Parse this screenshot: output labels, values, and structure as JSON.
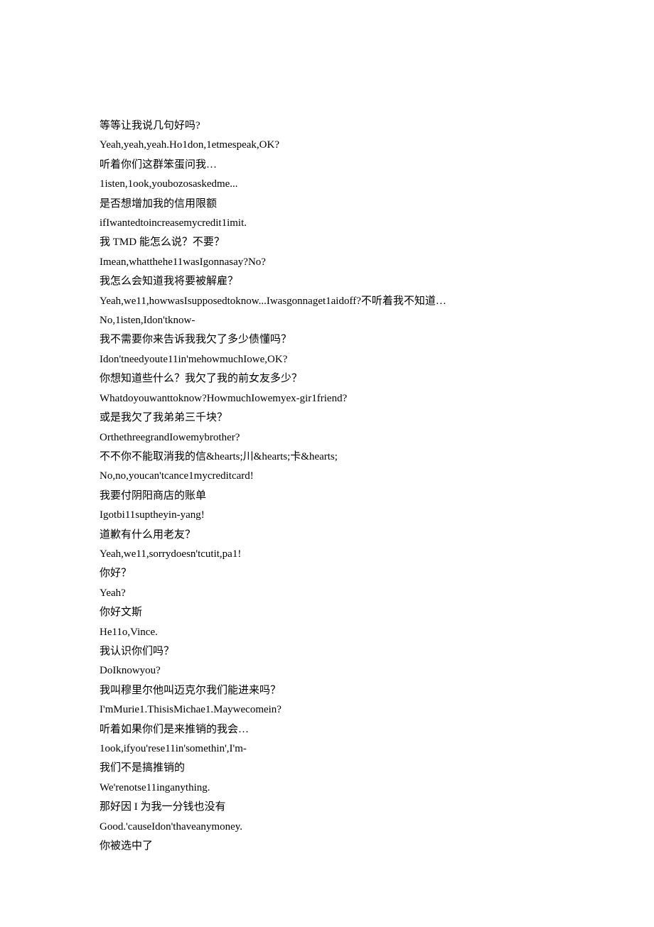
{
  "lines": [
    "等等让我说几句好吗?",
    "Yeah,yeah,yeah.Ho1don,1etmespeak,OK?",
    "听着你们这群笨蛋问我…",
    "1isten,1ook,youbozosaskedme...",
    "是否想增加我的信用限额",
    "ifIwantedtoincreasemycredit1imit.",
    "我 TMD 能怎么说？不要？",
    "Imean,whatthehe11wasIgonnasay?No?",
    "我怎么会知道我将要被解雇？",
    "Yeah,we11,howwasIsupposedtoknow...Iwasgonnaget1aidoff?不听着我不知道…",
    "No,1isten,Idon'tknow-",
    "我不需要你来告诉我我欠了多少债懂吗？",
    "Idon'tneedyoute11in'mehowmuchIowe,OK?",
    "你想知道些什么？我欠了我的前女友多少？",
    "Whatdoyouwanttoknow?HowmuchIowemyex-gir1friend?",
    "或是我欠了我弟弟三千块？",
    "OrthethreegrandIowemybrother?",
    "不不你不能取消我的信&hearts;川&hearts;卡&hearts;",
    "No,no,youcan'tcance1mycreditcard!",
    "我要付阴阳商店的账单",
    "Igotbi11suptheyin-yang!",
    "道歉有什么用老友？",
    "Yeah,we11,sorrydoesn'tcutit,pa1!",
    "你好？",
    "Yeah?",
    "你好文斯",
    "He11o,Vince.",
    "我认识你们吗？",
    "DoIknowyou?",
    "我叫穆里尔他叫迈克尔我们能进来吗？",
    "I'mMurie1.ThisisMichae1.Maywecomein?",
    "听着如果你们是来推销的我会…",
    "1ook,ifyou'rese11in'somethin',I'm-",
    "我们不是搞推销的",
    "We'renotse11inganything.",
    "那好因 I 为我一分钱也没有",
    "Good.'causeIdon'thaveanymoney.",
    "你被选中了"
  ]
}
